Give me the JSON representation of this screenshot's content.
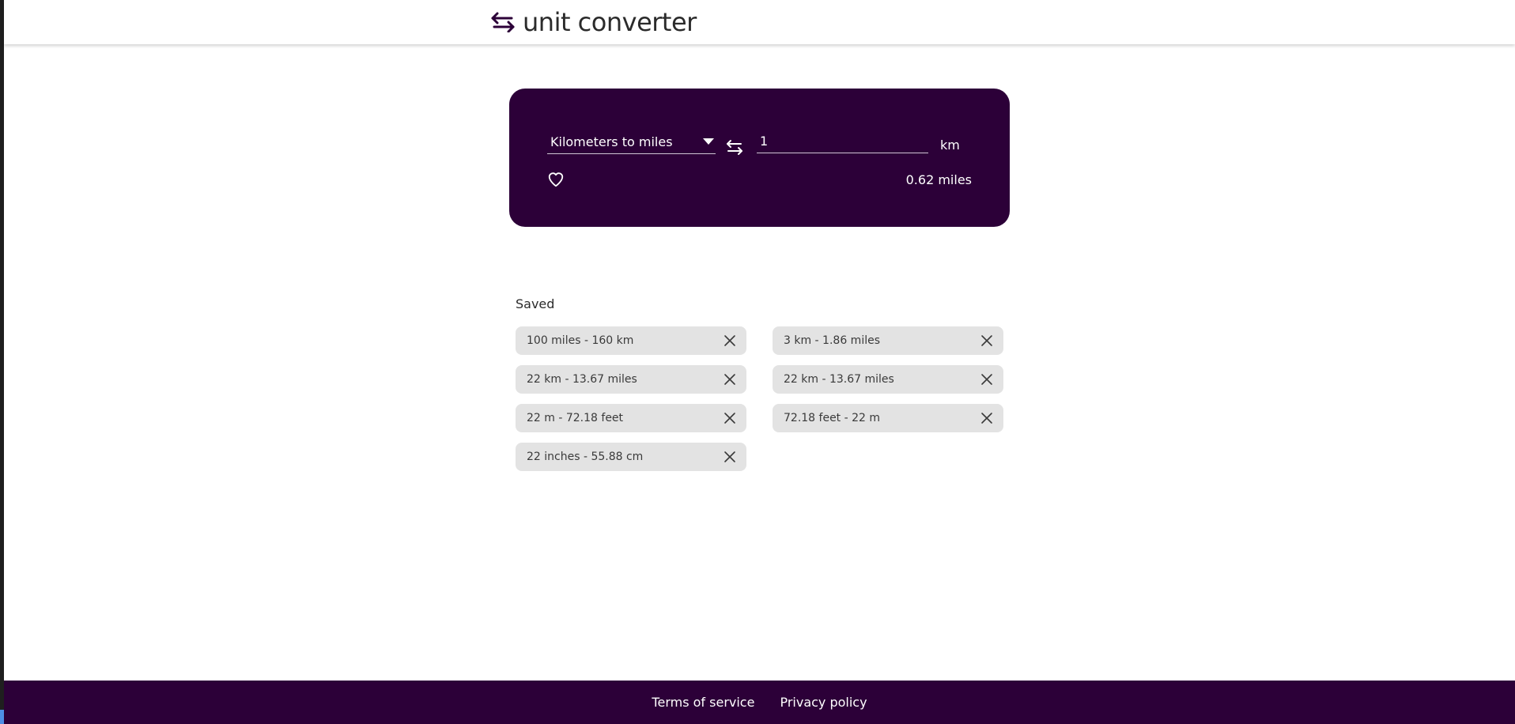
{
  "header": {
    "title": "unit converter",
    "logo_icon": "swap-arrows-icon"
  },
  "converter": {
    "conversion_select_label": "Kilometers to miles",
    "caret_icon": "chevron-down-icon",
    "swap_icon": "swap-arrows-icon",
    "amount_value": "1",
    "unit": "km",
    "favorite_icon": "heart-icon",
    "result": "0.62 miles",
    "background_color": "#2c0038"
  },
  "saved": {
    "title": "Saved",
    "items": [
      {
        "label": "100 miles - 160 km"
      },
      {
        "label": "3 km - 1.86 miles"
      },
      {
        "label": "22 km - 13.67 miles"
      },
      {
        "label": "22 km - 13.67 miles"
      },
      {
        "label": "22 m - 72.18 feet"
      },
      {
        "label": "72.18 feet - 22 m"
      },
      {
        "label": "22 inches - 55.88 cm"
      }
    ],
    "remove_icon": "close-icon"
  },
  "footer": {
    "links": [
      {
        "label": "Terms of service"
      },
      {
        "label": "Privacy policy"
      }
    ]
  }
}
